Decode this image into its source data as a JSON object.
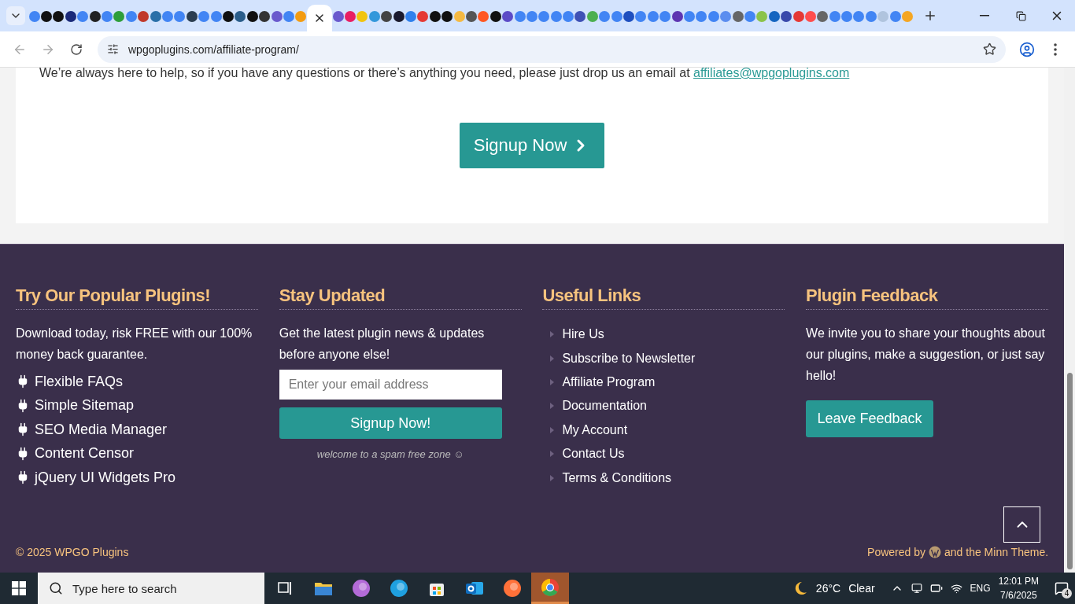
{
  "browser": {
    "tabs": [
      {
        "color": "#4285f4",
        "selected": false
      },
      {
        "color": "#111111",
        "selected": false
      },
      {
        "color": "#111111",
        "selected": false
      },
      {
        "color": "#1a2a7a",
        "selected": false
      },
      {
        "color": "#4285f4",
        "selected": false
      },
      {
        "color": "#222222",
        "selected": false
      },
      {
        "color": "#4285f4",
        "selected": false
      },
      {
        "color": "#2e9e3a",
        "selected": false
      },
      {
        "color": "#4285f4",
        "selected": false
      },
      {
        "color": "#c0392b",
        "selected": false
      },
      {
        "color": "#2a6fa8",
        "selected": false
      },
      {
        "color": "#4285f4",
        "selected": false
      },
      {
        "color": "#4285f4",
        "selected": false
      },
      {
        "color": "#2c3e50",
        "selected": false
      },
      {
        "color": "#4285f4",
        "selected": false
      },
      {
        "color": "#4285f4",
        "selected": false
      },
      {
        "color": "#111111",
        "selected": false
      },
      {
        "color": "#2a5d8a",
        "selected": false
      },
      {
        "color": "#111111",
        "selected": false
      },
      {
        "color": "#333333",
        "selected": false
      },
      {
        "color": "#6a5acd",
        "selected": false
      },
      {
        "color": "#4285f4",
        "selected": false
      },
      {
        "color": "#f39c12",
        "selected": false
      },
      {
        "selected": true
      },
      {
        "color": "#6a5acd",
        "selected": false
      },
      {
        "color": "#e91e63",
        "selected": false
      },
      {
        "color": "#f1c40f",
        "selected": false
      },
      {
        "color": "#3498db",
        "selected": false
      },
      {
        "color": "#444444",
        "selected": false
      },
      {
        "color": "#1a1a2e",
        "selected": false
      },
      {
        "color": "#2f80ed",
        "selected": false
      },
      {
        "color": "#e53935",
        "selected": false
      },
      {
        "color": "#111111",
        "selected": false
      },
      {
        "color": "#111111",
        "selected": false
      },
      {
        "color": "#f5b942",
        "selected": false
      },
      {
        "color": "#555555",
        "selected": false
      },
      {
        "color": "#ff5722",
        "selected": false
      },
      {
        "color": "#111111",
        "selected": false
      },
      {
        "color": "#5c4bc7",
        "selected": false
      },
      {
        "color": "#4285f4",
        "selected": false
      },
      {
        "color": "#4285f4",
        "selected": false
      },
      {
        "color": "#4285f4",
        "selected": false
      },
      {
        "color": "#4285f4",
        "selected": false
      },
      {
        "color": "#4285f4",
        "selected": false
      },
      {
        "color": "#3f51b5",
        "selected": false
      },
      {
        "color": "#4caf50",
        "selected": false
      },
      {
        "color": "#4285f4",
        "selected": false
      },
      {
        "color": "#4285f4",
        "selected": false
      },
      {
        "color": "#1e4fbf",
        "selected": false
      },
      {
        "color": "#4285f4",
        "selected": false
      },
      {
        "color": "#4285f4",
        "selected": false
      },
      {
        "color": "#4285f4",
        "selected": false
      },
      {
        "color": "#5e35b1",
        "selected": false
      },
      {
        "color": "#4285f4",
        "selected": false
      },
      {
        "color": "#4285f4",
        "selected": false
      },
      {
        "color": "#4285f4",
        "selected": false
      },
      {
        "color": "#5b8def",
        "selected": false
      },
      {
        "color": "#666666",
        "selected": false
      },
      {
        "color": "#4285f4",
        "selected": false
      },
      {
        "color": "#8bc34a",
        "selected": false
      },
      {
        "color": "#1565c0",
        "selected": false
      },
      {
        "color": "#3949ab",
        "selected": false
      },
      {
        "color": "#e53935",
        "selected": false
      },
      {
        "color": "#ff4d4d",
        "selected": false
      },
      {
        "color": "#666666",
        "selected": false
      },
      {
        "color": "#4285f4",
        "selected": false
      },
      {
        "color": "#4285f4",
        "selected": false
      },
      {
        "color": "#4285f4",
        "selected": false
      },
      {
        "color": "#4285f4",
        "selected": false
      },
      {
        "color": "#b0c4de",
        "selected": false
      },
      {
        "color": "#4285f4",
        "selected": false
      },
      {
        "color": "#f5a623",
        "selected": false
      }
    ],
    "url": "wpgoplugins.com/affiliate-program/"
  },
  "page": {
    "help_text": "We’re always here to help, so if you have any questions or there’s anything you need, please just drop us an email at",
    "email_link": "affiliates@wpgoplugins.com",
    "signup_button": "Signup Now"
  },
  "footer": {
    "plugins": {
      "heading": "Try Our Popular Plugins!",
      "text": "Download today, risk FREE with our 100% money back guarantee.",
      "items": [
        "Flexible FAQs",
        "Simple Sitemap",
        "SEO Media Manager",
        "Content Censor",
        "jQuery UI Widgets Pro"
      ]
    },
    "updates": {
      "heading": "Stay Updated",
      "text": "Get the latest plugin news & updates before anyone else!",
      "email_placeholder": "Enter your email address",
      "button": "Signup Now!",
      "note": "welcome to a spam free zone ☺"
    },
    "links": {
      "heading": "Useful Links",
      "items": [
        "Hire Us",
        "Subscribe to Newsletter",
        "Affiliate Program",
        "Documentation",
        "My Account",
        "Contact Us",
        "Terms & Conditions"
      ]
    },
    "feedback": {
      "heading": "Plugin Feedback",
      "text": "We invite you to share your thoughts about our plugins, make a suggestion, or just say hello!",
      "button": "Leave Feedback"
    },
    "copyright": "© 2025 WPGO Plugins",
    "powered_by": "Powered by",
    "theme_text": "and the Minn Theme."
  },
  "taskbar": {
    "search_placeholder": "Type here to search",
    "apps": [
      {
        "kind": "taskview",
        "selected": false
      },
      {
        "kind": "folder",
        "selected": false
      },
      {
        "kind": "copilot",
        "selected": false
      },
      {
        "kind": "edge",
        "selected": false
      },
      {
        "kind": "store",
        "selected": false
      },
      {
        "kind": "outlook",
        "selected": false
      },
      {
        "kind": "firefox",
        "selected": false
      },
      {
        "kind": "chrome",
        "selected": true
      }
    ],
    "temperature": "26°C",
    "weather": "Clear",
    "language": "ENG",
    "time": "12:01 PM",
    "date": "7/6/2025",
    "notifications": "4"
  }
}
